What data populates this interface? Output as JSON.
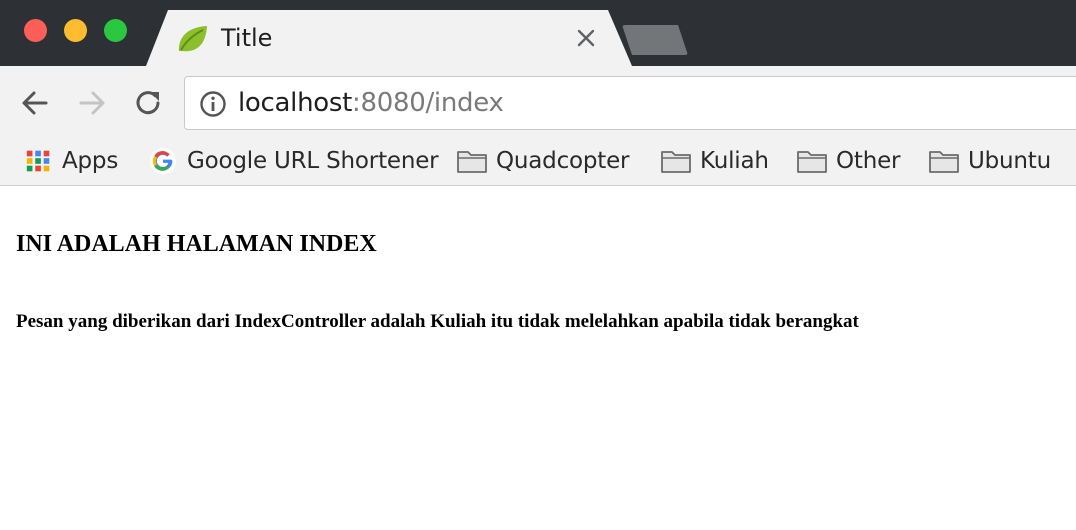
{
  "tab": {
    "title": "Title",
    "favicon": "spring-leaf-icon",
    "close": "close-icon"
  },
  "toolbar": {
    "back": "back-arrow-icon",
    "forward": "forward-arrow-icon",
    "reload": "reload-icon",
    "address": {
      "host": "localhost",
      "rest": ":8080/index",
      "security_icon": "info-icon"
    }
  },
  "bookmarks": {
    "items": [
      {
        "label": "Apps",
        "icon": "apps-grid-icon"
      },
      {
        "label": "Google URL Shortener",
        "icon": "google-icon"
      },
      {
        "label": "Quadcopter",
        "icon": "folder-icon"
      },
      {
        "label": "Kuliah",
        "icon": "folder-icon"
      },
      {
        "label": "Other",
        "icon": "folder-icon"
      },
      {
        "label": "Ubuntu",
        "icon": "folder-icon"
      }
    ]
  },
  "page": {
    "heading": "INI ADALAH HALAMAN INDEX",
    "message": "Pesan yang diberikan dari IndexController adalah Kuliah itu tidak melelahkan apabila tidak berangkat"
  },
  "colors": {
    "titlebar": "#2d3135",
    "toolbar": "#f2f2f2",
    "traffic_close": "#fd5e57",
    "traffic_minimize": "#febc2e",
    "traffic_maximize": "#2ac840"
  }
}
